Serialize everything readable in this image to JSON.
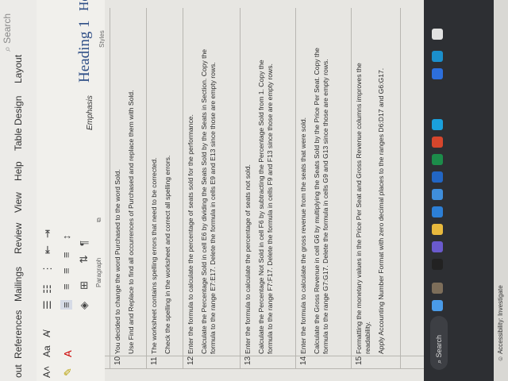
{
  "tabs": [
    "out",
    "References",
    "Mailings",
    "Review",
    "View",
    "Help",
    "Table Design",
    "Layout"
  ],
  "search_label": "Search",
  "ribbon": {
    "font_size_label": "Aa",
    "paragraph_label": "Paragraph",
    "styles_label": "Styles",
    "style_heading1": "Heading 1",
    "style_emphasis": "Emphasis",
    "style_heading_partial": "Head",
    "pilcrow": "¶"
  },
  "rows": [
    {
      "num": "10",
      "lines": [
        "You decided to change the word Purchased to the word Sold.",
        "Use Find and Replace to find all occurrences of Purchased and replace them with Sold."
      ]
    },
    {
      "num": "11",
      "lines": [
        "The worksheet contains spelling errors that need to be corrected.",
        "Check the spelling in the worksheet and correct all spelling errors."
      ]
    },
    {
      "num": "12",
      "lines": [
        "Enter the formula to calculate the percentage of seats sold for the performance.",
        "Calculate the Percentage Sold in cell E6 by dividing the Seats Sold by the Seats in Section. Copy the formula to the range E7:E17. Delete the formula in cells E9 and E13 since those are empty rows."
      ]
    },
    {
      "num": "13",
      "lines": [
        "Enter the formula to calculate the percentage of seats not sold.",
        "Calculate the Percentage Not Sold in cell F6 by subtracting the Percentage Sold from 1. Copy the formula to the range F7:F17. Delete the formula in cells F9 and F13 since those are empty rows."
      ]
    },
    {
      "num": "14",
      "lines": [
        "Enter the formula to calculate the gross revenue from the seats that were sold.",
        "Calculate the Gross Revenue in cell G6 by multiplying the Seats Sold by the Price Per Seat. Copy the formula to the range G7:G17. Delete the formula in cells G9 and G13 since those are empty rows."
      ]
    },
    {
      "num": "15",
      "lines": [
        "Formatting the monetary values in the Price Per Seat and Gross Revenue columns improves the readability.",
        "Apply Accounting Number Format with zero decimal places to the ranges D6:D17 and G6:G17."
      ]
    }
  ],
  "status": {
    "accessibility": "Accessibility: Investigate"
  },
  "taskbar": {
    "search": "Search"
  }
}
